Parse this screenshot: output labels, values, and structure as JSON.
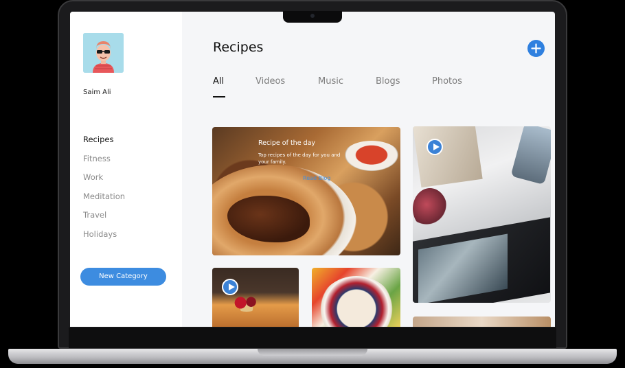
{
  "user": {
    "name": "Saim Ali",
    "avatar_icon": "avatar-icon"
  },
  "sidebar": {
    "items": [
      {
        "label": "Recipes",
        "active": true
      },
      {
        "label": "Fitness",
        "active": false
      },
      {
        "label": "Work",
        "active": false
      },
      {
        "label": "Meditation",
        "active": false
      },
      {
        "label": "Travel",
        "active": false
      },
      {
        "label": "Holidays",
        "active": false
      }
    ],
    "new_category_label": "New Category"
  },
  "header": {
    "title": "Recipes",
    "add_icon": "plus-icon"
  },
  "tabs": [
    {
      "label": "All",
      "active": true
    },
    {
      "label": "Videos",
      "active": false
    },
    {
      "label": "Music",
      "active": false
    },
    {
      "label": "Blogs",
      "active": false
    },
    {
      "label": "Photos",
      "active": false
    }
  ],
  "featured": {
    "title": "Recipe of the day",
    "subtitle": "Top recipes of the day for you and your family.",
    "link_label": "Read Blog"
  },
  "colors": {
    "accent": "#3d8ce0",
    "sidebar_bg": "#ffffff",
    "content_bg": "#f5f6f8"
  }
}
